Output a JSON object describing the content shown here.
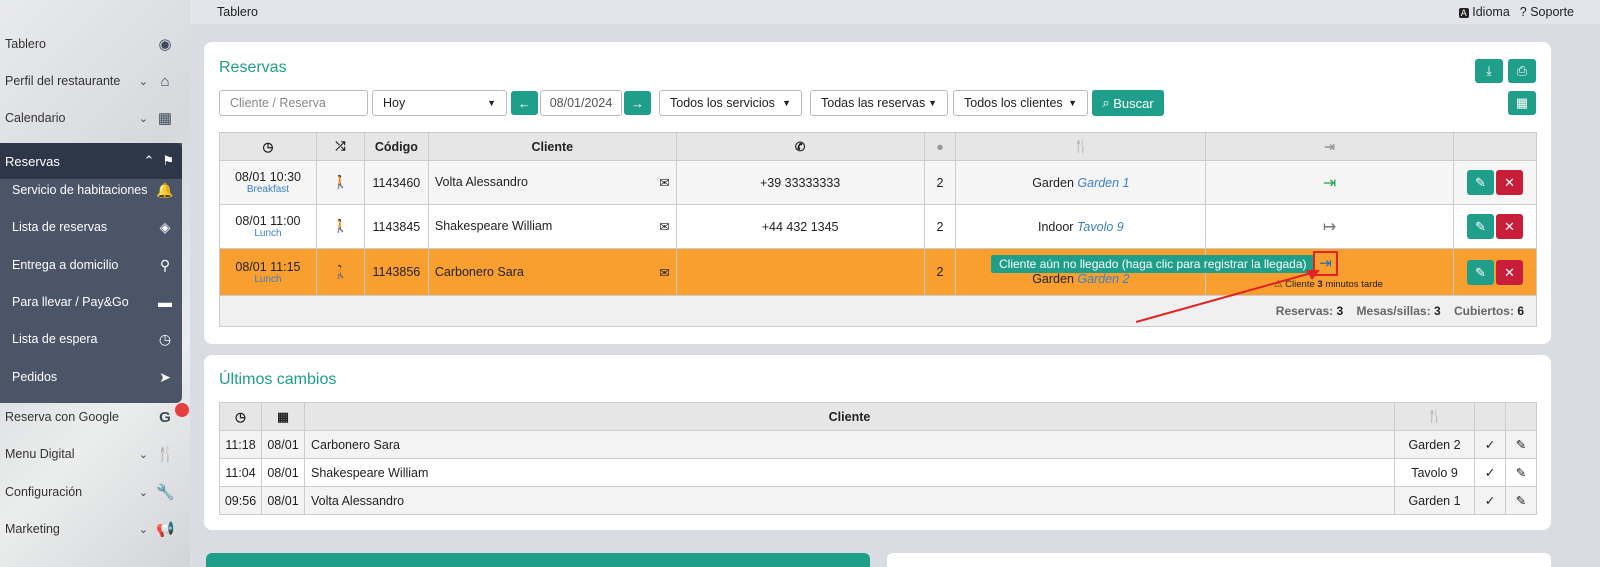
{
  "topbar": {
    "title": "Tablero",
    "language": "Idioma",
    "support": "Soporte"
  },
  "sidebar": {
    "items": [
      {
        "label": "Tablero"
      },
      {
        "label": "Perfil del restaurante"
      },
      {
        "label": "Calendario"
      },
      {
        "label": "Reservas"
      },
      {
        "label": "Reserva con Google"
      },
      {
        "label": "Menu Digital"
      },
      {
        "label": "Configuración"
      },
      {
        "label": "Marketing"
      }
    ],
    "sub_items": [
      {
        "label": "Servicio de habitaciones"
      },
      {
        "label": "Lista de reservas"
      },
      {
        "label": "Entrega a domicilio"
      },
      {
        "label": "Para llevar / Pay&Go"
      },
      {
        "label": "Lista de espera"
      },
      {
        "label": "Pedidos"
      }
    ]
  },
  "reservas": {
    "title": "Reservas",
    "search_placeholder": "Cliente  / Reserva",
    "period": "Hoy",
    "date": "08/01/2024",
    "services": "Todos los servicios",
    "reservations": "Todas las reservas",
    "clients": "Todos los clientes",
    "search_button": "Buscar",
    "headers": {
      "code": "Código",
      "client": "Cliente"
    },
    "rows": [
      {
        "time": "08/01 10:30",
        "service": "Breakfast",
        "code": "1143460",
        "client": "Volta Alessandro",
        "phone": "+39 33333333",
        "people": "2",
        "room": "Garden",
        "table": "Garden 1",
        "status": "arrived"
      },
      {
        "time": "08/01 11:00",
        "service": "Lunch",
        "code": "1143845",
        "client": "Shakespeare William",
        "phone": "+44 432 1345",
        "people": "2",
        "room": "Indoor",
        "table": "Tavolo 9",
        "status": "left"
      },
      {
        "time": "08/01 11:15",
        "service": "Lunch",
        "code": "1143856",
        "client": "Carbonero Sara",
        "phone": "",
        "people": "2",
        "room": "Garden",
        "table": "Garden 2",
        "status": "not-arrived"
      }
    ],
    "tooltip": "Cliente aún no llegado (haga clic para registrar la llegada)",
    "late_prefix": "Cliente",
    "late_minutes": "3",
    "late_suffix": "minutos tarde",
    "footer": {
      "reservas_label": "Reservas:",
      "reservas_value": "3",
      "mesas_label": "Mesas/sillas:",
      "mesas_value": "3",
      "cubiertos_label": "Cubiertos:",
      "cubiertos_value": "6"
    }
  },
  "cambios": {
    "title": "Últimos cambios",
    "client_header": "Cliente",
    "rows": [
      {
        "time": "11:18",
        "date": "08/01",
        "client": "Carbonero Sara",
        "table": "Garden 2"
      },
      {
        "time": "11:04",
        "date": "08/01",
        "client": "Shakespeare William",
        "table": "Tavolo 9"
      },
      {
        "time": "09:56",
        "date": "08/01",
        "client": "Volta Alessandro",
        "table": "Garden 1"
      }
    ]
  },
  "colors": {
    "accent": "#1f9e89",
    "danger": "#c81e3a",
    "highlight_row": "#f99f30",
    "sidebar_dark": "#2d3748"
  }
}
